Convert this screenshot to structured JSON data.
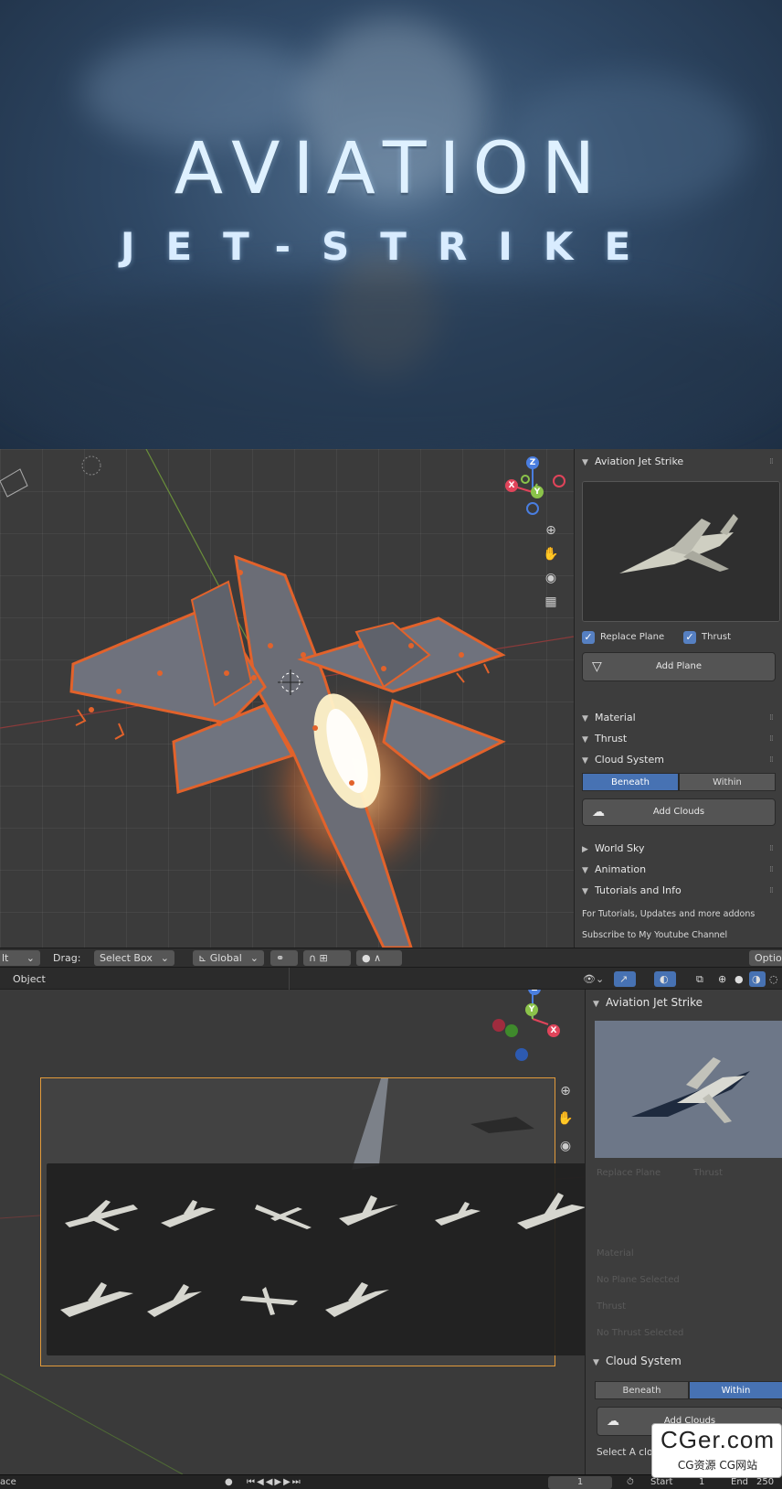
{
  "hero": {
    "title": "AVIATION",
    "subtitle": "JET-STRIKE"
  },
  "panel1": {
    "header": "Aviation Jet Strike",
    "replace_plane": {
      "label": "Replace Plane",
      "checked": true
    },
    "thrust": {
      "label": "Thrust",
      "checked": true
    },
    "add_plane": "Add Plane",
    "sections": {
      "material": "Material",
      "thrust": "Thrust",
      "cloud_system": "Cloud System",
      "world_sky": "World Sky",
      "animation": "Animation",
      "tutorials": "Tutorials and Info"
    },
    "cloud_toggle": {
      "beneath": "Beneath",
      "within": "Within",
      "active": "Beneath"
    },
    "add_clouds": "Add Clouds",
    "tutorials_text": "For Tutorials, Updates and more addons",
    "subscribe_text": "Subscribe to My Youtube Channel"
  },
  "toolbar": {
    "mode_fragment": "lt",
    "drag_label": "Drag:",
    "select_box": "Select Box",
    "orientation": "Global",
    "options": "Option"
  },
  "header2": {
    "object_menu": "Object"
  },
  "panel2": {
    "header": "Aviation Jet Strike",
    "replace_plane": "Replace Plane",
    "thrust": "Thrust",
    "material": "Material",
    "no_plane": "No Plane Selected",
    "thrust_section": "Thrust",
    "no_thrust": "No Thrust Selected",
    "cloud_system": "Cloud System",
    "cloud_toggle": {
      "beneath": "Beneath",
      "within": "Within",
      "active": "Within"
    },
    "add_clouds": "Add Clouds",
    "select_text": "Select A clo"
  },
  "timeline": {
    "left_fragment": "ace",
    "frame": "1",
    "start_label": "Start",
    "start": "1",
    "end_label": "End",
    "end": "250"
  },
  "gizmo": {
    "x": "X",
    "y": "Y",
    "z": "Z"
  },
  "watermark": {
    "main": "CGer.com",
    "sub": "CG资源 CG网站"
  },
  "colors": {
    "accent": "#4772b3",
    "selection": "#e2622b",
    "camera_frame": "#e29a3b"
  }
}
